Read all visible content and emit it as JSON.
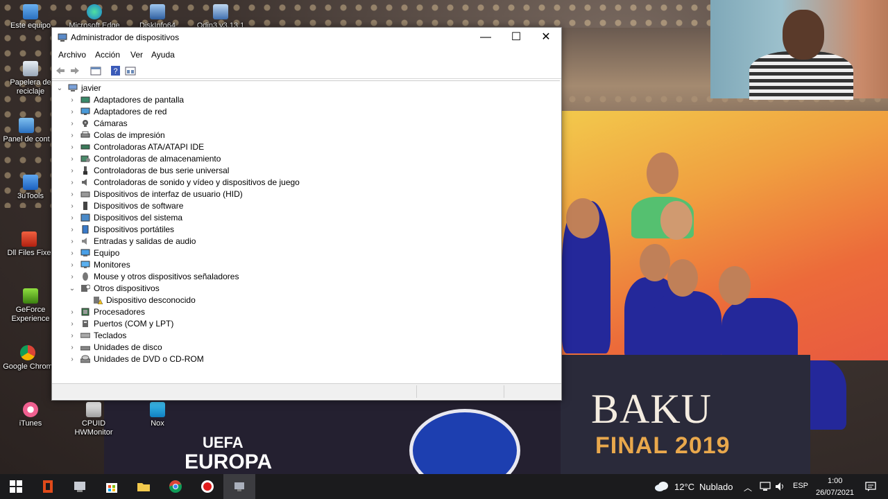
{
  "desktop": {
    "icons": [
      {
        "label": "Este equipo",
        "icon": "computer-icon"
      },
      {
        "label": "Microsoft Edge",
        "icon": "edge-icon"
      },
      {
        "label": "DiskInfo64",
        "icon": "diskinfo-icon"
      },
      {
        "label": "Odin3 v3.13.1",
        "icon": "odin-icon"
      },
      {
        "label": "Papelera de reciclaje",
        "icon": "recycle-bin-icon"
      },
      {
        "label": "Panel de cont",
        "icon": "control-panel-icon"
      },
      {
        "label": "3uTools",
        "icon": "3utools-icon"
      },
      {
        "label": "Dll Files Fixe",
        "icon": "dll-files-icon"
      },
      {
        "label": "GeForce Experience",
        "icon": "geforce-icon"
      },
      {
        "label": "Google Chrom",
        "icon": "chrome-icon"
      },
      {
        "label": "iTunes",
        "icon": "itunes-icon"
      },
      {
        "label": "CPUID HWMonitor",
        "icon": "cpuid-icon"
      },
      {
        "label": "Nox",
        "icon": "nox-icon"
      }
    ],
    "wallpaper": {
      "text_1": "BAKU",
      "text_2": "FINAL 2019",
      "text_3": "UEFA",
      "text_4": "EUROPA"
    }
  },
  "window": {
    "title": "Administrador de dispositivos",
    "controls": {
      "minimize": "—",
      "maximize": "☐",
      "close": "✕"
    },
    "menu": [
      "Archivo",
      "Acción",
      "Ver",
      "Ayuda"
    ],
    "toolbar": [
      "back-arrow-icon",
      "forward-arrow-icon",
      "properties-icon",
      "help-icon",
      "view-icon"
    ],
    "tree": {
      "root": "javier",
      "categories": [
        {
          "label": "Adaptadores de pantalla",
          "expanded": false
        },
        {
          "label": "Adaptadores de red",
          "expanded": false
        },
        {
          "label": "Cámaras",
          "expanded": false
        },
        {
          "label": "Colas de impresión",
          "expanded": false
        },
        {
          "label": "Controladoras ATA/ATAPI IDE",
          "expanded": false
        },
        {
          "label": "Controladoras de almacenamiento",
          "expanded": false
        },
        {
          "label": "Controladoras de bus serie universal",
          "expanded": false
        },
        {
          "label": "Controladoras de sonido y vídeo y dispositivos de juego",
          "expanded": false
        },
        {
          "label": "Dispositivos de interfaz de usuario (HID)",
          "expanded": false
        },
        {
          "label": "Dispositivos de software",
          "expanded": false
        },
        {
          "label": "Dispositivos del sistema",
          "expanded": false
        },
        {
          "label": "Dispositivos portátiles",
          "expanded": false
        },
        {
          "label": "Entradas y salidas de audio",
          "expanded": false
        },
        {
          "label": "Equipo",
          "expanded": false
        },
        {
          "label": "Monitores",
          "expanded": false
        },
        {
          "label": "Mouse y otros dispositivos señaladores",
          "expanded": false
        },
        {
          "label": "Otros dispositivos",
          "expanded": true,
          "children": [
            "Dispositivo desconocido"
          ]
        },
        {
          "label": "Procesadores",
          "expanded": false
        },
        {
          "label": "Puertos (COM y LPT)",
          "expanded": false
        },
        {
          "label": "Teclados",
          "expanded": false
        },
        {
          "label": "Unidades de disco",
          "expanded": false
        },
        {
          "label": "Unidades de DVD o CD-ROM",
          "expanded": false
        }
      ]
    }
  },
  "taskbar": {
    "apps": [
      "start-icon",
      "office-icon",
      "explorer-app-icon",
      "store-icon",
      "file-explorer-icon",
      "chrome-icon",
      "recorder-icon",
      "device-manager-icon"
    ],
    "weather": {
      "temp": "12°C",
      "condition": "Nublado"
    },
    "language": "ESP",
    "time": "1:00",
    "date": "26/07/2021"
  }
}
